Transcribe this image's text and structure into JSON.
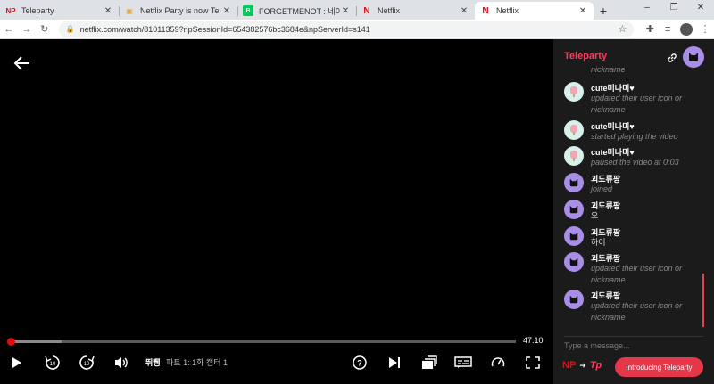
{
  "browser": {
    "tabs": [
      {
        "label": "Teleparty",
        "favicon": "NP",
        "favicon_color": "#e50914",
        "active": false
      },
      {
        "label": "Netflix Party is now Telepa",
        "favicon": "▣",
        "favicon_color": "#e8a33c",
        "active": false
      },
      {
        "label": "FORGETMENOT : 네이버 블",
        "favicon": "B",
        "favicon_color": "#03c75a",
        "active": false
      },
      {
        "label": "Netflix",
        "favicon": "N",
        "favicon_color": "#e50914",
        "active": false
      },
      {
        "label": "Netflix",
        "favicon": "N",
        "favicon_color": "#e50914",
        "active": true
      }
    ],
    "new_tab": "+",
    "window_controls": [
      "–",
      "❐",
      "✕"
    ],
    "url": "netflix.com/watch/81011359?npSessionId=654382576bc3684e&npServerId=s141"
  },
  "player": {
    "time_remaining": "47:10",
    "progress": 0.005,
    "buffered": 0.1,
    "title": "뛰뛩",
    "episode": "파트 1: 1화 캡터 1",
    "colors": {
      "accent": "#e50914"
    }
  },
  "sidebar": {
    "title": "Teleparty",
    "messages": [
      {
        "user": "",
        "avatar": "popsicle",
        "text": "nickname",
        "italic": true
      },
      {
        "user": "cute미나미♥",
        "avatar": "popsicle",
        "text": "updated their user icon or nickname",
        "italic": true
      },
      {
        "user": "cute미나미♥",
        "avatar": "popsicle",
        "text": "started playing the video",
        "italic": true
      },
      {
        "user": "cute미나미♥",
        "avatar": "popsicle",
        "text": "paused the video at 0:03",
        "italic": true
      },
      {
        "user": "괴도류팡",
        "avatar": "cat",
        "text": "joined",
        "italic": true
      },
      {
        "user": "괴도류팡",
        "avatar": "cat",
        "text": "오",
        "italic": false
      },
      {
        "user": "괴도류팡",
        "avatar": "cat",
        "text": "하이",
        "italic": false
      },
      {
        "user": "괴도류팡",
        "avatar": "cat",
        "text": "updated their user icon or nickname",
        "italic": true
      },
      {
        "user": "괴도류팡",
        "avatar": "cat",
        "text": "updated their user icon or nickname",
        "italic": true
      }
    ],
    "input_placeholder": "Type a message...",
    "logo_np": "NP",
    "logo_arrow": "➜",
    "logo_tp": "Tp",
    "intro_button": "Introducing Teleparty",
    "colors": {
      "brand": "#ff3b5c",
      "button": "#e6374a"
    }
  }
}
